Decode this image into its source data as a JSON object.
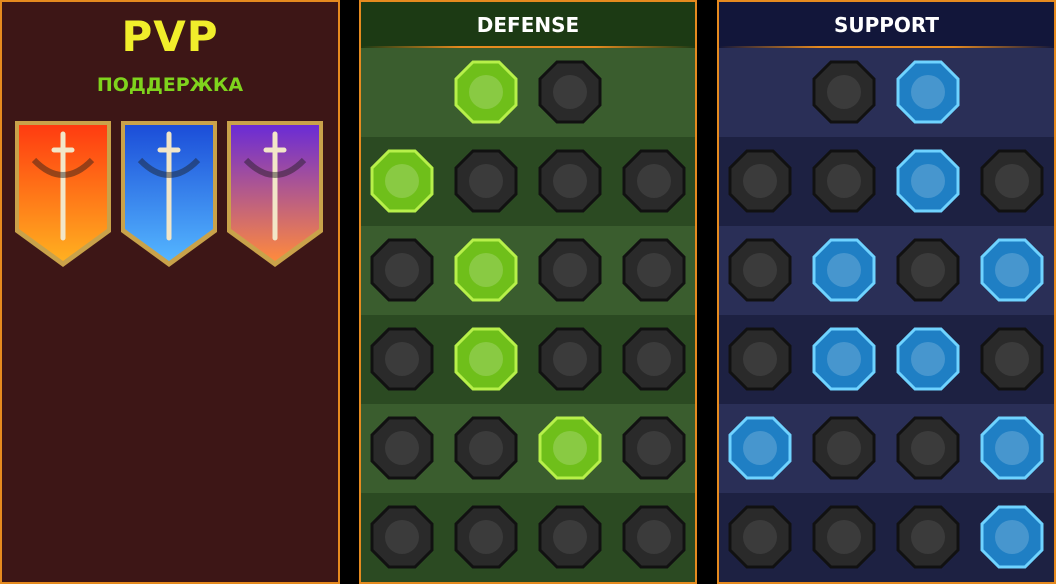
{
  "left": {
    "title": "PVP",
    "subtitle": "ПОДДЕРЖКА",
    "banners": [
      {
        "icon": "red-sword-banner",
        "colors": [
          "#ff3b10",
          "#ffb020"
        ]
      },
      {
        "icon": "blue-triple-sword-banner",
        "colors": [
          "#1b4dd8",
          "#54b6ff"
        ]
      },
      {
        "icon": "purple-crossed-swords-banner",
        "colors": [
          "#6a2bd6",
          "#ff8a3d"
        ]
      }
    ]
  },
  "defense": {
    "title": "DEFENSE",
    "accent": "#8fe01f",
    "rows": [
      [
        null,
        {
          "icon": "stair-blocks-icon",
          "active": true
        },
        {
          "icon": "raised-fist-icon",
          "active": false
        },
        null
      ],
      [
        {
          "icon": "chevron-shield-icon",
          "active": true
        },
        {
          "icon": "heart-organ-icon",
          "active": false
        },
        {
          "icon": "armored-torso-icon",
          "active": false
        },
        {
          "icon": "crossed-blades-icon",
          "active": false
        }
      ],
      [
        {
          "icon": "punching-figure-icon",
          "active": false
        },
        {
          "icon": "knight-shield-icon",
          "active": true
        },
        {
          "icon": "heart-skull-icon",
          "active": false
        },
        {
          "icon": "hooded-figure-icon",
          "active": false
        }
      ],
      [
        {
          "icon": "cheering-crowd-icon",
          "active": false
        },
        {
          "icon": "hourglass-alien-icon",
          "active": true
        },
        {
          "icon": "open-hand-icon",
          "active": false
        },
        {
          "icon": "bull-head-icon",
          "active": false
        }
      ],
      [
        {
          "icon": "dashing-runner-icon",
          "active": false
        },
        {
          "icon": "claw-marks-icon",
          "active": false
        },
        {
          "icon": "sun-skull-icon",
          "active": true
        },
        {
          "icon": "slashing-arm-icon",
          "active": false
        }
      ],
      [
        {
          "icon": "flaming-warrior-icon",
          "active": false
        },
        {
          "icon": "winged-shield-icon",
          "active": false
        },
        {
          "icon": "bearded-face-icon",
          "active": false
        },
        {
          "icon": "flexing-man-icon",
          "active": false
        }
      ]
    ]
  },
  "support": {
    "title": "SUPPORT",
    "accent": "#3fb4f0",
    "rows": [
      [
        null,
        {
          "icon": "heart-plus-icon",
          "active": false
        },
        {
          "icon": "glowing-hand-icon",
          "active": true
        },
        null
      ],
      [
        {
          "icon": "praying-hands-icon",
          "active": false
        },
        {
          "icon": "rainbow-shield-icon",
          "active": false
        },
        {
          "icon": "flaming-skull-icon",
          "active": true
        },
        {
          "icon": "speed-boot-icon",
          "active": false
        }
      ],
      [
        {
          "icon": "sparkle-figure-icon",
          "active": false
        },
        {
          "icon": "lightning-bolt-icon",
          "active": true
        },
        {
          "icon": "cracked-ground-icon",
          "active": false
        },
        {
          "icon": "shadow-figures-icon",
          "active": true
        }
      ],
      [
        {
          "icon": "chained-heart-icon",
          "active": false
        },
        {
          "icon": "flaming-fist-icon",
          "active": true
        },
        {
          "icon": "open-book-icon",
          "active": true
        },
        {
          "icon": "angry-eyes-icon",
          "active": false
        }
      ],
      [
        {
          "icon": "compass-star-icon",
          "active": true
        },
        {
          "icon": "running-boot-icon",
          "active": false
        },
        {
          "icon": "all-seeing-eye-icon",
          "active": false
        },
        {
          "icon": "crossbones-figure-icon",
          "active": true
        }
      ],
      [
        {
          "icon": "potion-flask-icon",
          "active": false
        },
        {
          "icon": "skull-crest-icon",
          "active": false
        },
        {
          "icon": "gripping-fist-icon",
          "active": false
        },
        {
          "icon": "eagle-head-icon",
          "active": true
        }
      ]
    ]
  }
}
